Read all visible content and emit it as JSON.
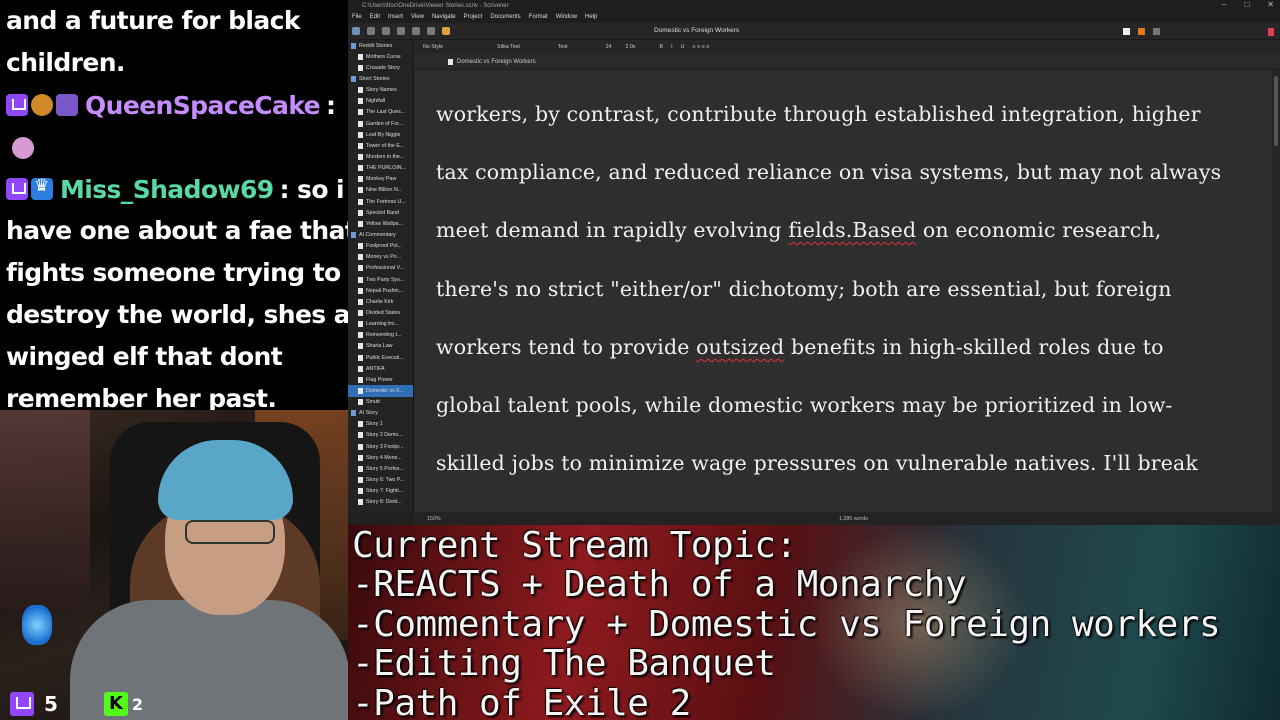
{
  "chat": {
    "lines_top": [
      "and a future for black",
      "children."
    ],
    "user1": {
      "name": "QueenSpaceCake",
      "color": "#c58cff",
      "text": ":"
    },
    "user2": {
      "name": "Miss_Shadow69",
      "color": "#5ad7a8",
      "text": ": so i"
    },
    "lines_bottom": [
      "have one about a fae that",
      "fights someone trying to",
      "destroy the world, shes a",
      "winged elf that dont",
      "remember her past."
    ]
  },
  "webcam": {
    "twitch_viewers": "5",
    "kick_viewers": "2"
  },
  "app": {
    "window_path": "C:\\Users\\ttoc\\OneDrive\\Viewer Stories.scriv - Scrivener",
    "menu": [
      "File",
      "Edit",
      "Insert",
      "View",
      "Navigate",
      "Project",
      "Documents",
      "Format",
      "Window",
      "Help"
    ],
    "doc_title": "Domestic vs Foreign Workers",
    "format": {
      "style": "No Style",
      "font": "Sitka Text",
      "variant": "Text",
      "size": "24",
      "spacing": "2.0x"
    },
    "header_title": "Domestic vs Foreign Workers",
    "zoom": "150%",
    "word_count": "1,280 words",
    "binder": [
      {
        "label": "Reddit Stories",
        "type": "folder"
      },
      {
        "label": "Mothers Curse",
        "type": "doc"
      },
      {
        "label": "Crusade Story",
        "type": "doc"
      },
      {
        "label": "Short Stories",
        "type": "folder"
      },
      {
        "label": "Story Names",
        "type": "doc"
      },
      {
        "label": "Nightfall",
        "type": "doc"
      },
      {
        "label": "The Last Ques...",
        "type": "doc"
      },
      {
        "label": "Garden of For...",
        "type": "doc"
      },
      {
        "label": "Leaf By Niggle",
        "type": "doc"
      },
      {
        "label": "Tower of the E...",
        "type": "doc"
      },
      {
        "label": "Murders in the...",
        "type": "doc"
      },
      {
        "label": "THE PURLOIN...",
        "type": "doc"
      },
      {
        "label": "Monkey Paw",
        "type": "doc"
      },
      {
        "label": "Nine Billion N...",
        "type": "doc"
      },
      {
        "label": "The Fortress U...",
        "type": "doc"
      },
      {
        "label": "Specled Band",
        "type": "doc"
      },
      {
        "label": "Yellow Wallpa...",
        "type": "doc"
      },
      {
        "label": "AI Commentary",
        "type": "folder"
      },
      {
        "label": "Foolproof Pol...",
        "type": "doc"
      },
      {
        "label": "Money vs Po...",
        "type": "doc"
      },
      {
        "label": "Professional V...",
        "type": "doc"
      },
      {
        "label": "Two Party Sys...",
        "type": "doc"
      },
      {
        "label": "Nepali Pushin...",
        "type": "doc"
      },
      {
        "label": "Charlie Kirk",
        "type": "doc"
      },
      {
        "label": "Divided States",
        "type": "doc"
      },
      {
        "label": "Learning fro...",
        "type": "doc"
      },
      {
        "label": "Reinventing t...",
        "type": "doc"
      },
      {
        "label": "Sharia Law",
        "type": "doc"
      },
      {
        "label": "Public Executi...",
        "type": "doc"
      },
      {
        "label": "ANTIFA",
        "type": "doc"
      },
      {
        "label": "Flag Power",
        "type": "doc"
      },
      {
        "label": "Domestic vs F...",
        "type": "doc",
        "selected": true
      },
      {
        "label": "Smutt",
        "type": "doc"
      },
      {
        "label": "AI Story",
        "type": "folder"
      },
      {
        "label": "Story 1",
        "type": "doc"
      },
      {
        "label": "Story 2 Demo...",
        "type": "doc"
      },
      {
        "label": "Story 3 Foolpr...",
        "type": "doc"
      },
      {
        "label": "Story 4 Mone...",
        "type": "doc"
      },
      {
        "label": "Story 5 Profes...",
        "type": "doc"
      },
      {
        "label": "Story 6: Two P...",
        "type": "doc"
      },
      {
        "label": "Story 7: Fighti...",
        "type": "doc"
      },
      {
        "label": "Story 8: Divid...",
        "type": "doc"
      }
    ],
    "editor": {
      "l1": "workers, by contrast, contribute through established integration, higher",
      "l2": "tax compliance, and reduced reliance on visa systems, but may not always",
      "l3a": "meet demand in rapidly evolving ",
      "l3b": "fields.Based",
      "l3c": " on economic research,",
      "l4": "there's no strict \"either/or\" dichotomy; both are essential, but foreign",
      "l5a": "workers tend to provide ",
      "l5b": "outsized",
      "l5c": " benefits in high-skilled roles due to",
      "l6": "global talent pools, while domestic workers may be prioritized in low-",
      "l7": "skilled jobs to minimize wage pressures on vulnerable natives. I'll break"
    }
  },
  "topic": {
    "lines": [
      "Current Stream Topic:",
      "-REACTS + Death of a Monarchy",
      "-Commentary + Domestic vs Foreign workers",
      "-Editing The Banquet",
      "-Path of Exile 2"
    ]
  }
}
